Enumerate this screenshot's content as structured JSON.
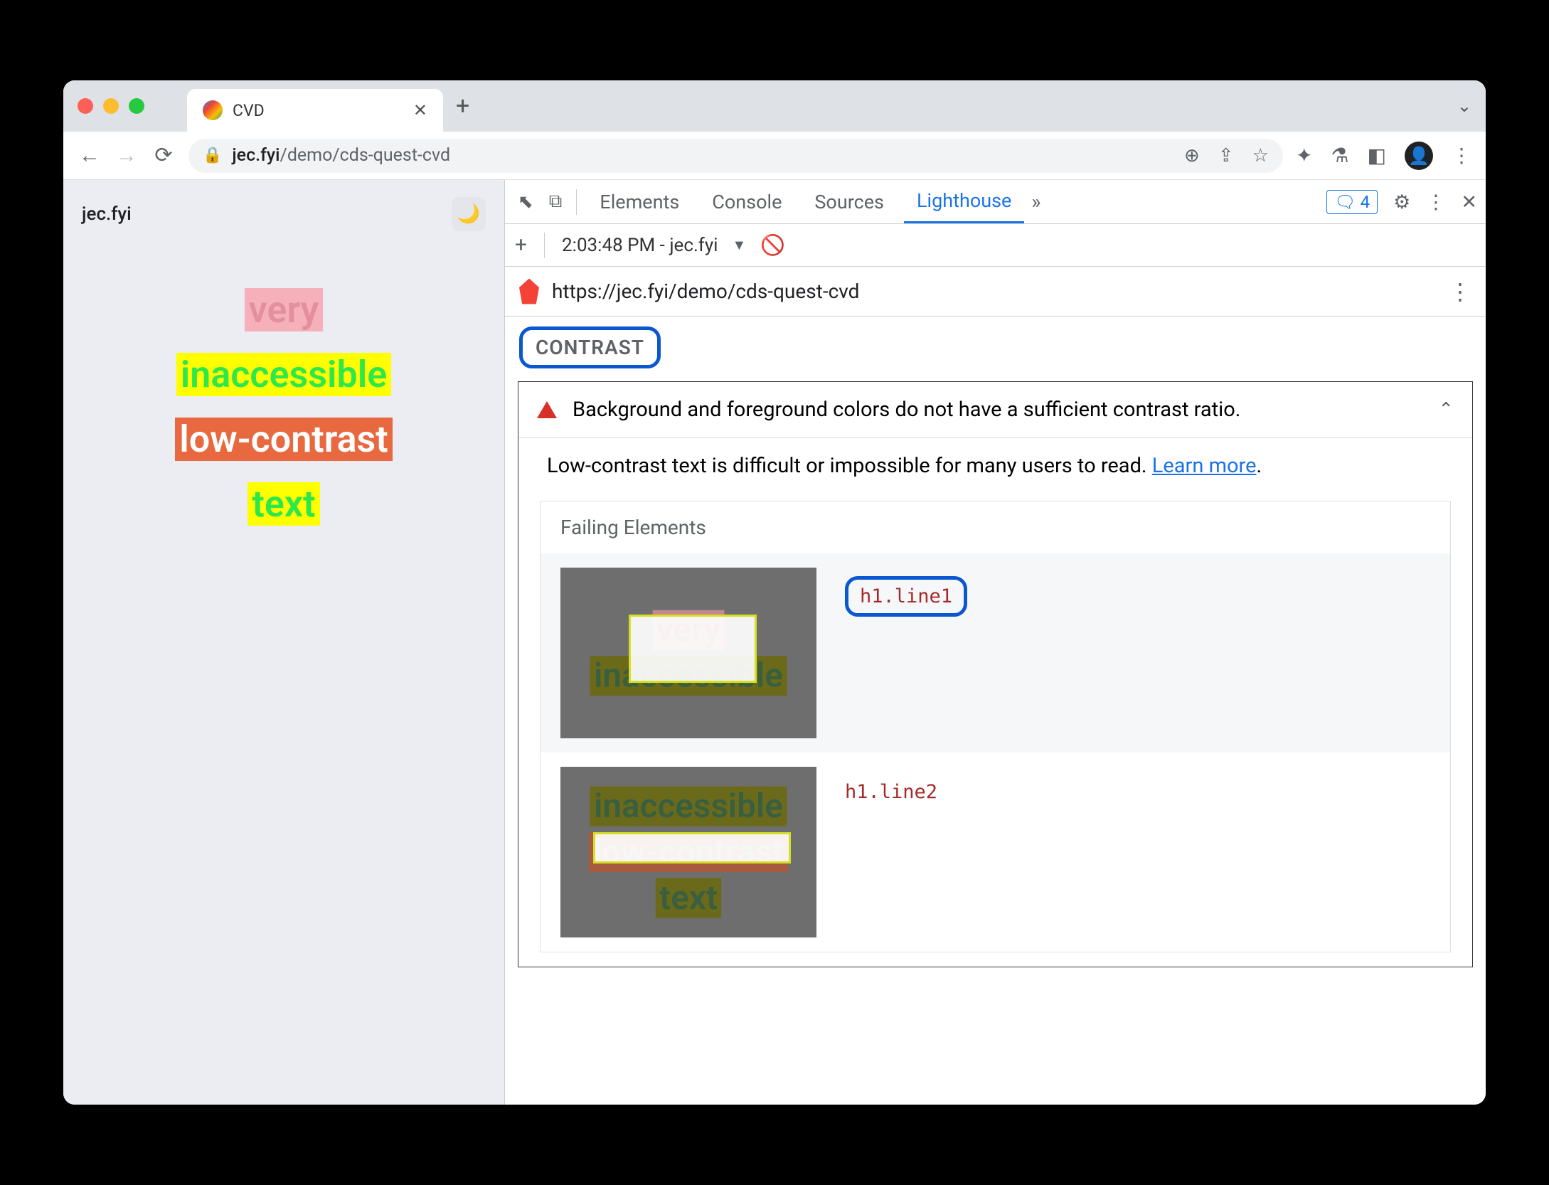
{
  "browser": {
    "tab_title": "CVD",
    "url_host": "jec.fyi",
    "url_path": "/demo/cds-quest-cvd"
  },
  "page": {
    "label": "jec.fyi",
    "line1": "very",
    "line2": "inaccessible",
    "line3": "low-contrast",
    "line4": "text"
  },
  "devtools": {
    "tabs": {
      "elements": "Elements",
      "console": "Console",
      "sources": "Sources",
      "lighthouse": "Lighthouse"
    },
    "feedback_count": "4"
  },
  "lighthouse": {
    "report_label": "2:03:48 PM - jec.fyi",
    "report_url": "https://jec.fyi/demo/cds-quest-cvd",
    "section_title": "CONTRAST",
    "audit_title": "Background and foreground colors do not have a sufficient contrast ratio.",
    "audit_description": "Low-contrast text is difficult or impossible for many users to read. ",
    "learn_more": "Learn more",
    "period": ".",
    "failing_title": "Failing Elements",
    "failing": [
      {
        "selector": "h1.line1"
      },
      {
        "selector": "h1.line2"
      }
    ]
  }
}
